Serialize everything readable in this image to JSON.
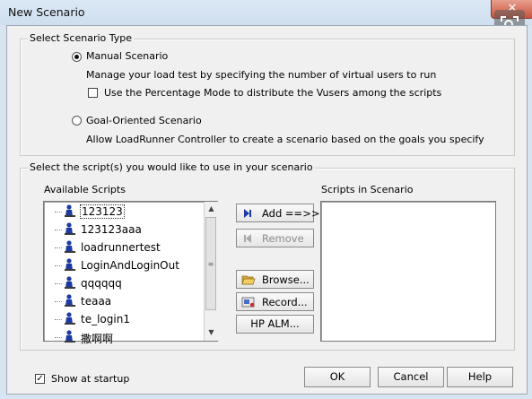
{
  "window": {
    "title": "New Scenario",
    "close_glyph": "✕"
  },
  "scenario_type": {
    "legend": "Select Scenario Type",
    "manual": {
      "label": "Manual Scenario",
      "description": "Manage your load test by specifying the number of virtual users to run",
      "percentage_mode_label": "Use the Percentage Mode to distribute the Vusers among the scripts",
      "percentage_mode_checked": false
    },
    "goal": {
      "label": "Goal-Oriented Scenario",
      "description": "Allow LoadRunner Controller to create a scenario based on the goals you specify"
    },
    "selected": "manual"
  },
  "scripts": {
    "legend": "Select the script(s) you would like to use in your scenario",
    "available_label": "Available Scripts",
    "in_scenario_label": "Scripts in Scenario",
    "available": [
      "123123",
      "123123aaa",
      "loadrunnertest",
      "LoginAndLoginOut",
      "qqqqqq",
      "teaaa",
      "te_login1",
      "撒啊啊"
    ],
    "focused_index": 0,
    "in_scenario": []
  },
  "buttons": {
    "add": "Add ==>>",
    "remove": "Remove",
    "browse": "Browse...",
    "record": "Record...",
    "hp_alm": "HP ALM...",
    "ok": "OK",
    "cancel": "Cancel",
    "help": "Help"
  },
  "footer": {
    "show_at_startup_label": "Show at startup",
    "show_at_startup_checked": true
  },
  "icons": [
    "zoom-icon",
    "script-icon",
    "add-arrow-icon",
    "remove-icon",
    "folder-open-icon",
    "record-icon"
  ],
  "colors": {
    "client_bg": "#f0f0f0",
    "frame": "#d8e4f0",
    "close": "#c7523c",
    "script_icon": "#1c3aa6"
  }
}
